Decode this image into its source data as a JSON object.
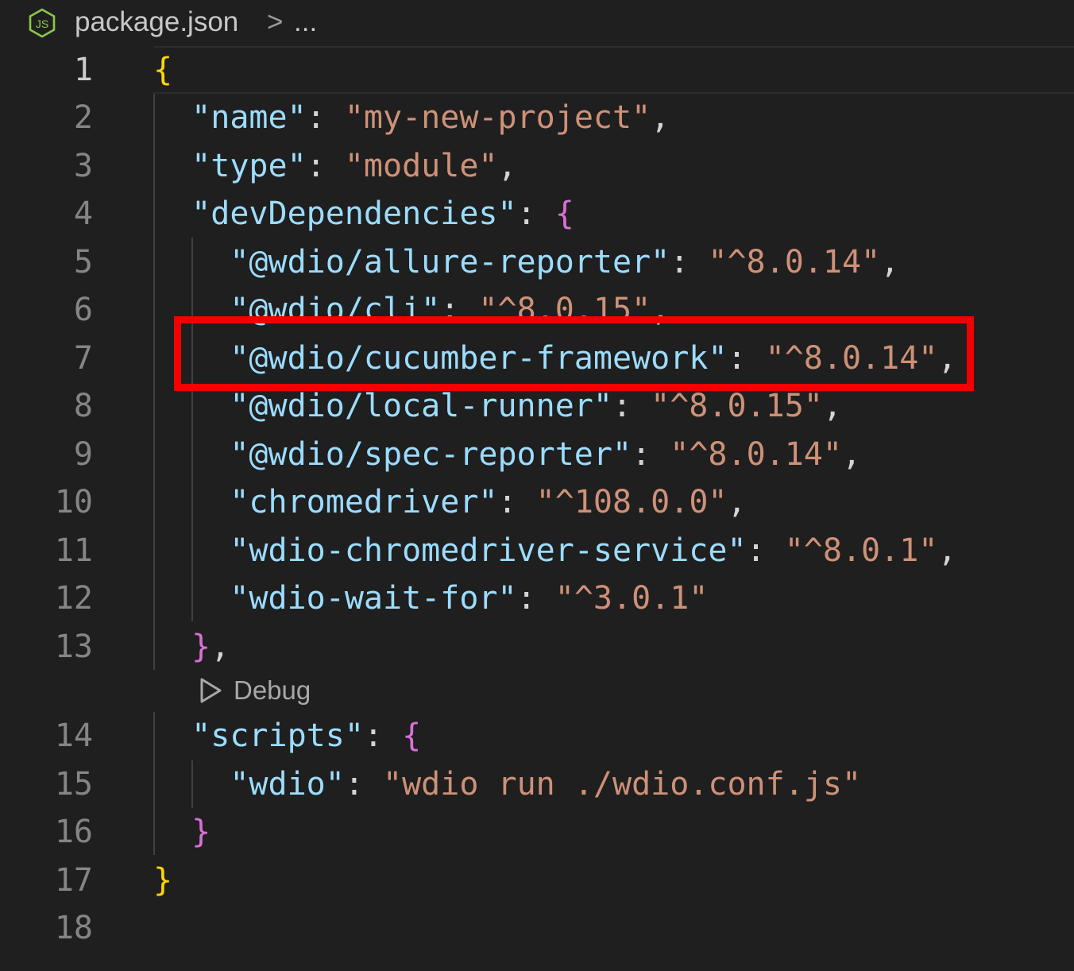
{
  "breadcrumb": {
    "file_icon": "nodejs-icon",
    "file_name": "package.json",
    "separator": ">",
    "ellipsis": "..."
  },
  "codelens": {
    "icon": "play-outline-icon",
    "label": "Debug"
  },
  "colors": {
    "background": "#1f1f1f",
    "key": "#9cdcfe",
    "string": "#ce9178",
    "bracket_level1": "#ffd700",
    "bracket_level2": "#da70d6",
    "highlight_box": "#f20000"
  },
  "lines": [
    {
      "n": "1"
    },
    {
      "n": "2",
      "key": "\"name\"",
      "value": "\"my-new-project\""
    },
    {
      "n": "3",
      "key": "\"type\"",
      "value": "\"module\""
    },
    {
      "n": "4",
      "key": "\"devDependencies\""
    },
    {
      "n": "5",
      "key": "\"@wdio/allure-reporter\"",
      "value": "\"^8.0.14\""
    },
    {
      "n": "6",
      "key": "\"@wdio/cli\"",
      "value": "\"^8.0.15\""
    },
    {
      "n": "7",
      "key": "\"@wdio/cucumber-framework\"",
      "value": "\"^8.0.14\""
    },
    {
      "n": "8",
      "key": "\"@wdio/local-runner\"",
      "value": "\"^8.0.15\""
    },
    {
      "n": "9",
      "key": "\"@wdio/spec-reporter\"",
      "value": "\"^8.0.14\""
    },
    {
      "n": "10",
      "key": "\"chromedriver\"",
      "value": "\"^108.0.0\""
    },
    {
      "n": "11",
      "key": "\"wdio-chromedriver-service\"",
      "value": "\"^8.0.1\""
    },
    {
      "n": "12",
      "key": "\"wdio-wait-for\"",
      "value": "\"^3.0.1\""
    },
    {
      "n": "13"
    },
    {
      "n": "14",
      "key": "\"scripts\""
    },
    {
      "n": "15",
      "key": "\"wdio\"",
      "value": "\"wdio run ./wdio.conf.js\""
    },
    {
      "n": "16"
    },
    {
      "n": "17"
    },
    {
      "n": "18"
    }
  ],
  "punct": {
    "open_brace": "{",
    "close_brace": "}",
    "close_brace_comma": "},",
    "colon": ": ",
    "comma": ","
  }
}
